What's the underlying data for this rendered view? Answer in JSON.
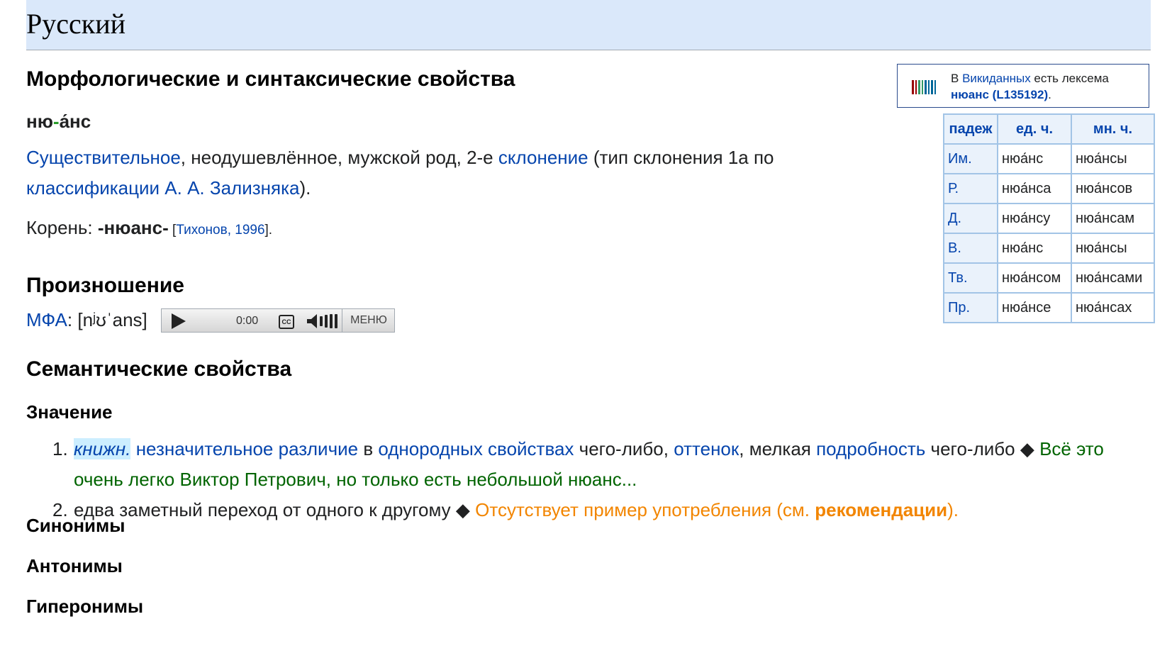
{
  "language": "Русский",
  "morph": {
    "heading": "Морфологические и синтаксические свойства",
    "word_part1": "ню",
    "word_dash": "-",
    "word_part2": "а́нс",
    "pos_link": "Существительное",
    "pos_rest": ", неодушевлённое, мужской род, 2-е ",
    "decl_link": "склонение",
    "decl_rest": " (тип склонения 1a по",
    "zal_link": "классификации А. А. Зализняка",
    "zal_end": ").",
    "root_label": "Корень: ",
    "root_value": "-нюанс-",
    "root_ref_open": " [",
    "root_ref": "Тихонов, 1996",
    "root_ref_close": "]."
  },
  "wikidata": {
    "line1_pre": "В ",
    "line1_link": "Викиданных",
    "line1_post": " есть лексема",
    "line2_link": "нюанс (L135192)",
    "line2_end": "."
  },
  "declension": {
    "headers": [
      "падеж",
      "ед. ч.",
      "мн. ч."
    ],
    "rows": [
      {
        "case": "Им.",
        "sg": "нюа́нс",
        "pl": "нюа́нсы"
      },
      {
        "case": "Р.",
        "sg": "нюа́нса",
        "pl": "нюа́нсов"
      },
      {
        "case": "Д.",
        "sg": "нюа́нсу",
        "pl": "нюа́нсам"
      },
      {
        "case": "В.",
        "sg": "нюа́нс",
        "pl": "нюа́нсы"
      },
      {
        "case": "Тв.",
        "sg": "нюа́нсом",
        "pl": "нюа́нсами"
      },
      {
        "case": "Пр.",
        "sg": "нюа́нсе",
        "pl": "нюа́нсах"
      }
    ]
  },
  "pronunciation": {
    "heading": "Произношение",
    "ipa_link": "МФА",
    "ipa_value": ": [nʲʊˈans]",
    "player": {
      "time": "0:00",
      "cc": "CC",
      "menu": "МЕНЮ"
    }
  },
  "semantics": {
    "heading": "Семантические свойства",
    "meaning_heading": "Значение",
    "meaning1": {
      "num": "1.",
      "label": "книжн.",
      "link1": "незначительное различие",
      "t1": " в ",
      "link2": "однородных свойствах",
      "t2": " чего-либо, ",
      "link3": "оттенок",
      "t3": ", мелкая ",
      "link4": "подробность",
      "t4": " чего-либо ◆ ",
      "example": "Всё это очень легко Виктор Петрович, но только есть небольшой нюанс..."
    },
    "meaning2": {
      "num": "2.",
      "text": "едва заметный переход от одного к другому ◆ ",
      "warn": "Отсутствует пример употребления (см. ",
      "warn_link": "рекомендации",
      "warn_end": ")."
    },
    "synonyms": "Синонимы",
    "antonyms": "Антонимы",
    "hypernyms": "Гиперонимы"
  },
  "colors": {
    "link": "#0645ad",
    "header_bg": "#dae8fa",
    "example": "#006400",
    "warning": "#f28500"
  }
}
